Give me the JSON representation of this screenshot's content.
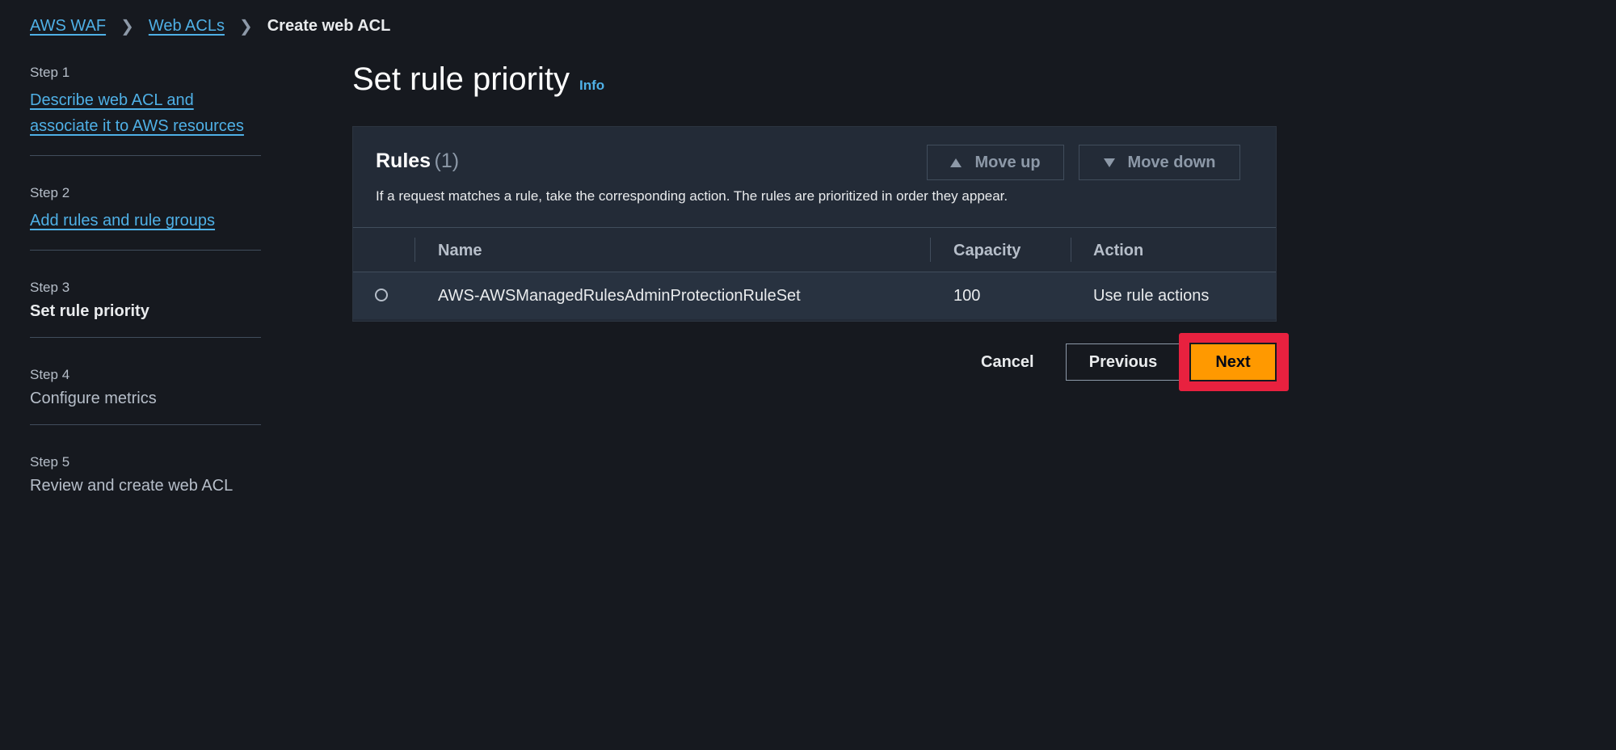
{
  "breadcrumb": {
    "items": [
      "AWS WAF",
      "Web ACLs"
    ],
    "current": "Create web ACL"
  },
  "steps": [
    {
      "num": "Step 1",
      "label": "Describe web ACL and associate it to AWS resources",
      "state": "link"
    },
    {
      "num": "Step 2",
      "label": "Add rules and rule groups",
      "state": "link"
    },
    {
      "num": "Step 3",
      "label": "Set rule priority",
      "state": "current"
    },
    {
      "num": "Step 4",
      "label": "Configure metrics",
      "state": "disabled"
    },
    {
      "num": "Step 5",
      "label": "Review and create web ACL",
      "state": "disabled"
    }
  ],
  "page": {
    "title": "Set rule priority",
    "info": "Info"
  },
  "rules_panel": {
    "title": "Rules",
    "count": "(1)",
    "description": "If a request matches a rule, take the corresponding action. The rules are prioritized in order they appear.",
    "move_up_label": "Move up",
    "move_down_label": "Move down",
    "columns": [
      "Name",
      "Capacity",
      "Action"
    ],
    "rows": [
      {
        "name": "AWS-AWSManagedRulesAdminProtectionRuleSet",
        "capacity": "100",
        "action": "Use rule actions"
      }
    ]
  },
  "actions": {
    "cancel": "Cancel",
    "previous": "Previous",
    "next": "Next"
  },
  "colors": {
    "accent": "#ff9900",
    "highlight": "#e8213f",
    "link": "#4fb0e6",
    "background": "#16191f"
  }
}
